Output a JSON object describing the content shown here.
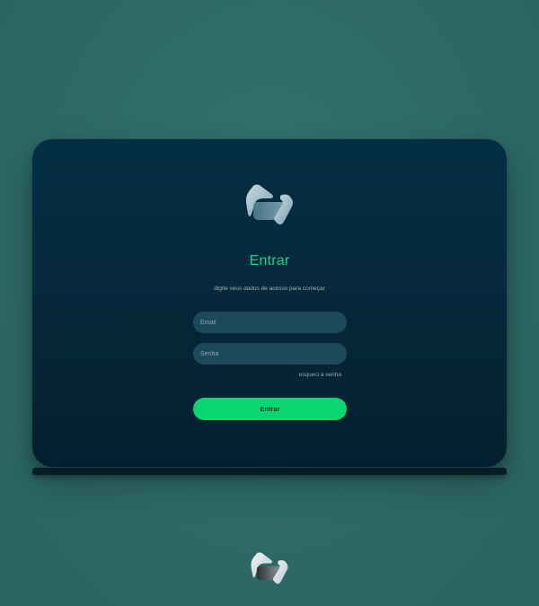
{
  "login": {
    "title": "Entrar",
    "subtitle": "digite seus dados de acesso para começar",
    "email_placeholder": "Email",
    "password_placeholder": "Senha",
    "forgot_label": "esqueci a senha",
    "submit_label": "Entrar"
  },
  "icons": {
    "main_logo": "brand-logo-icon",
    "footer_logo": "brand-logo-icon"
  },
  "colors": {
    "page_background": "#2e6b68",
    "card_top": "#042e44",
    "card_bottom": "#04202f",
    "accent": "#14d982",
    "button": "#0ad672",
    "field_background": "#1d4a5b"
  }
}
